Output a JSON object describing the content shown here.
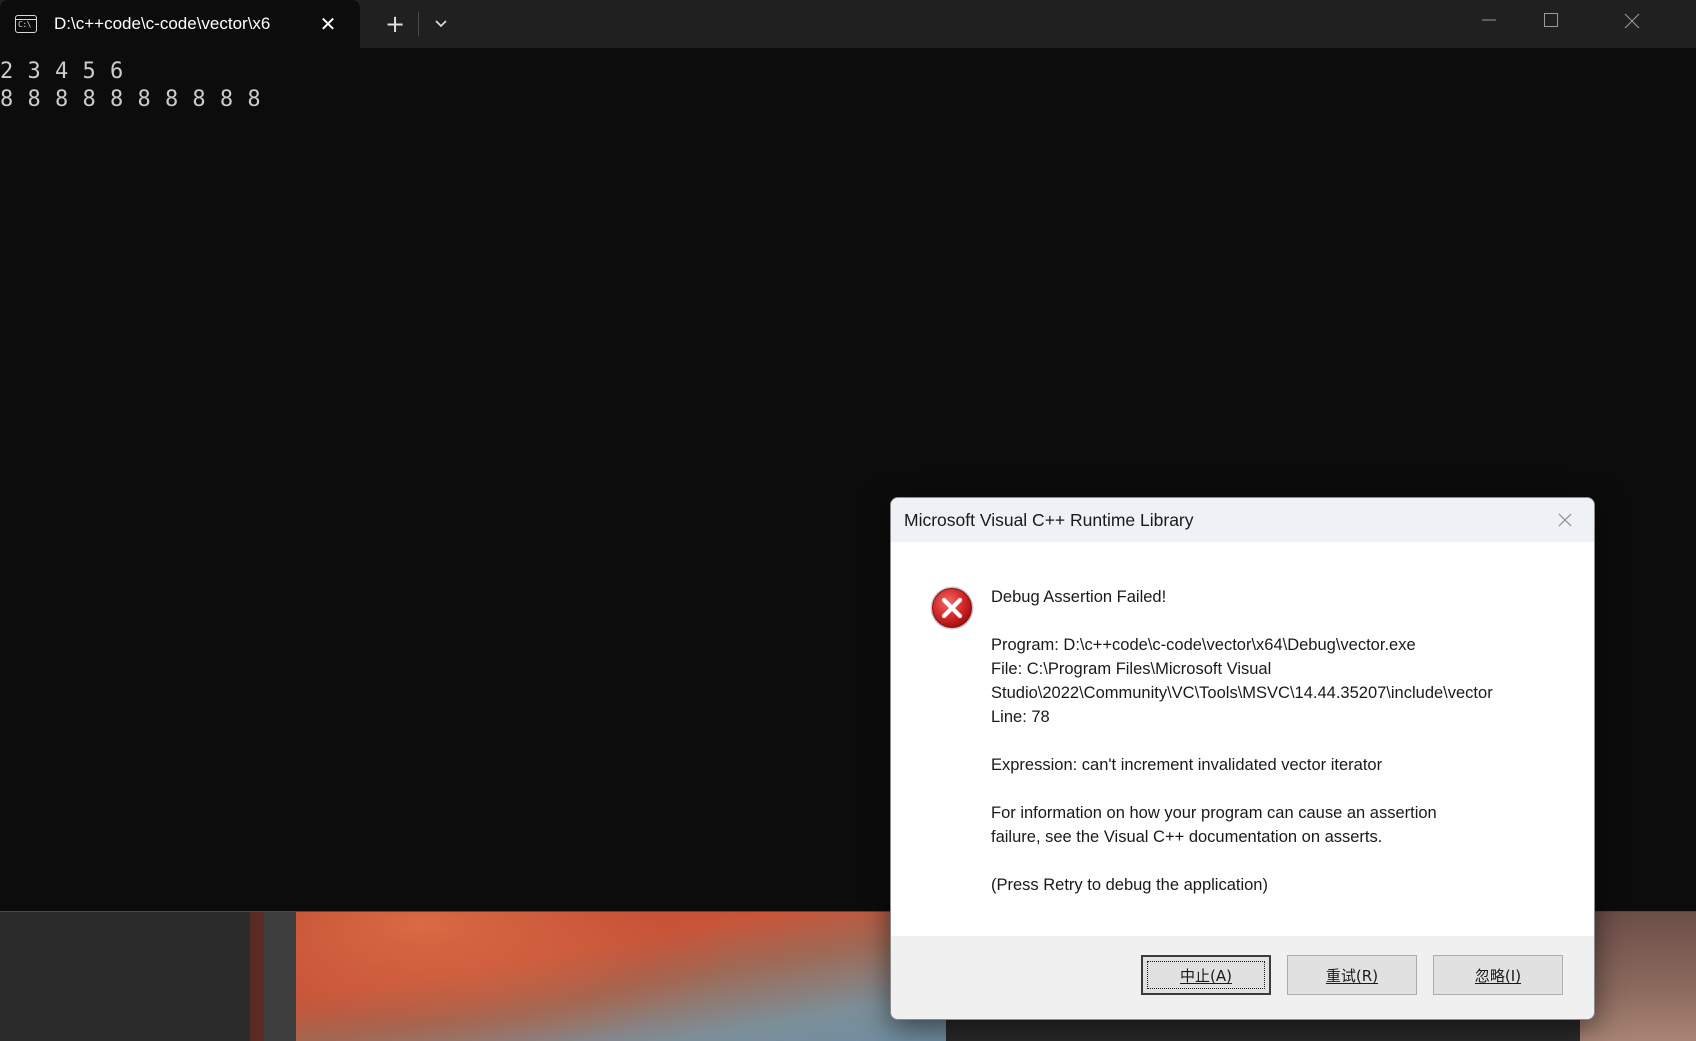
{
  "terminal": {
    "tab_title": "D:\\c++code\\c-code\\vector\\x6",
    "tab_icon": "C:\\",
    "close_tab_glyph": "✕",
    "new_tab_glyph": "+",
    "console_lines": [
      "2 3 4 5 6",
      "8 8 8 8 8 8 8 8 8 8"
    ]
  },
  "dialog": {
    "title": "Microsoft Visual C++ Runtime Library",
    "heading": "Debug Assertion Failed!",
    "program": "Program: D:\\c++code\\c-code\\vector\\x64\\Debug\\vector.exe",
    "file_line1": "File: C:\\Program Files\\Microsoft Visual",
    "file_line2": "Studio\\2022\\Community\\VC\\Tools\\MSVC\\14.44.35207\\include\\vector",
    "line": "Line: 78",
    "expression": "Expression: can't increment invalidated vector iterator",
    "info_line1": "For information on how your program can cause an assertion",
    "info_line2": "failure, see the Visual C++ documentation on asserts.",
    "retry_hint": "(Press Retry to debug the application)",
    "buttons": {
      "abort": "中止(A)",
      "retry": "重试(R)",
      "ignore": "忽略(I)"
    },
    "icon": "error-icon"
  },
  "colors": {
    "terminal_bg": "#0c0c0c",
    "titlebar_bg": "#202020",
    "console_text": "#cccccc",
    "error_red": "#d62828"
  }
}
